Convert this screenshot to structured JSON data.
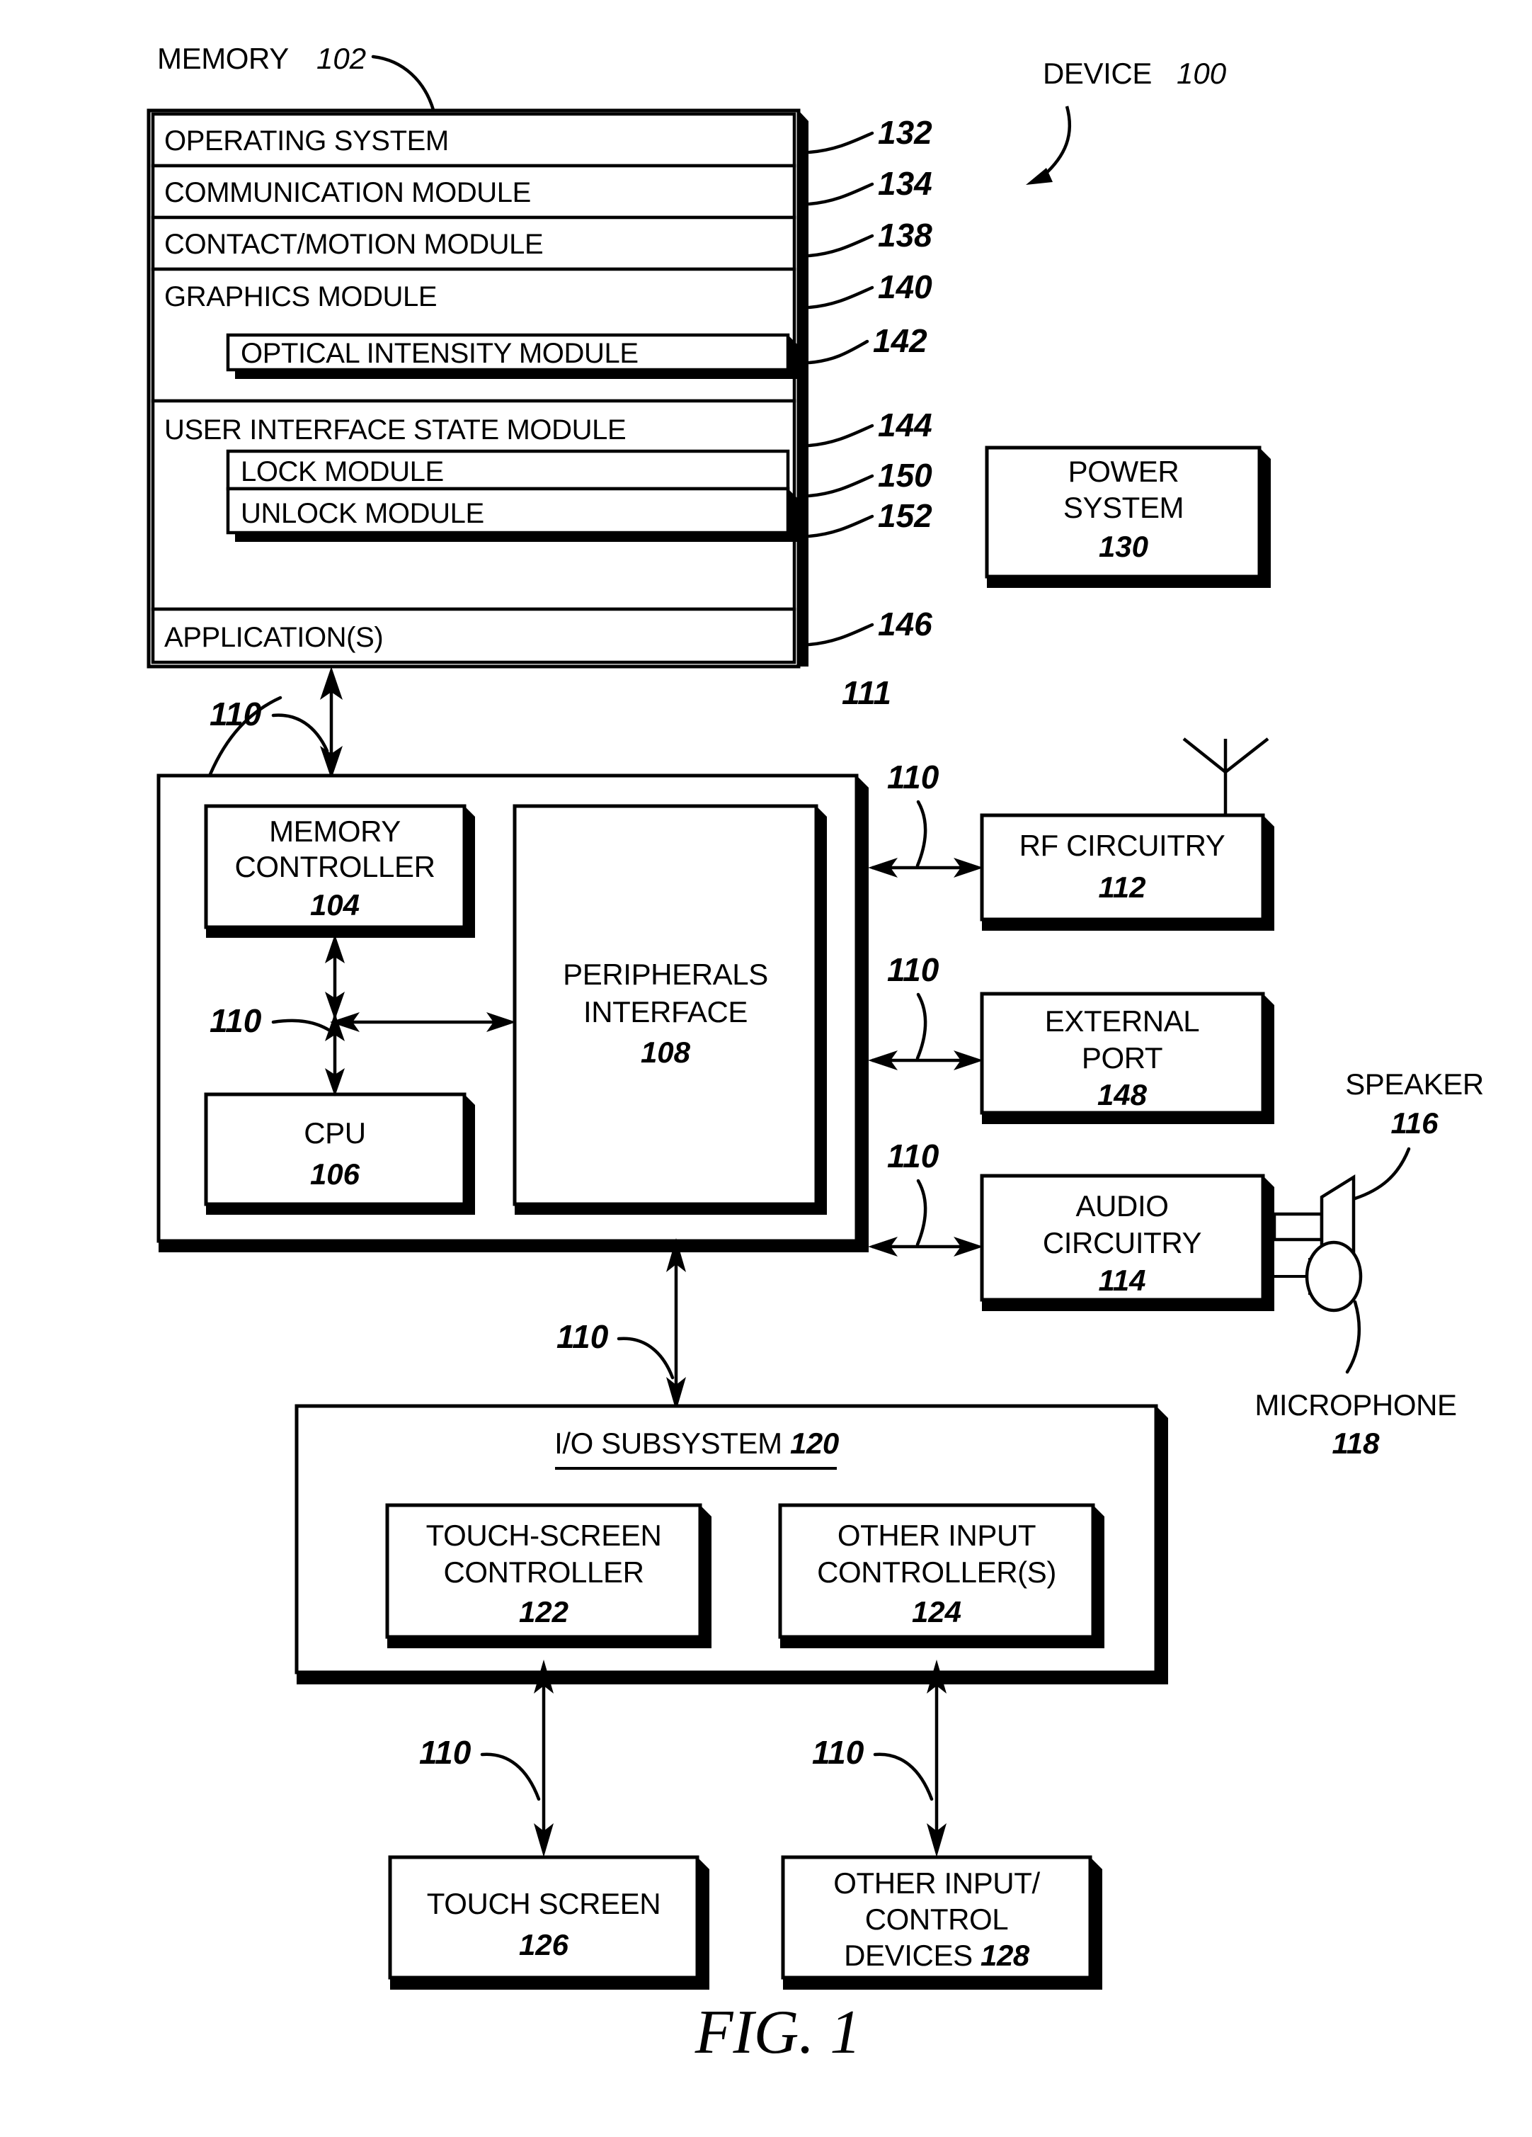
{
  "figure": {
    "caption": "FIG. 1",
    "device_label": "DEVICE",
    "device_ref": "100"
  },
  "memory": {
    "label": "MEMORY",
    "ref": "102",
    "modules": [
      {
        "name": "OPERATING SYSTEM",
        "ref": "132",
        "nested": false
      },
      {
        "name": "COMMUNICATION MODULE",
        "ref": "134",
        "nested": false
      },
      {
        "name": "CONTACT/MOTION MODULE",
        "ref": "138",
        "nested": false
      },
      {
        "name": "GRAPHICS MODULE",
        "ref": "140",
        "nested": false
      },
      {
        "name": "OPTICAL INTENSITY MODULE",
        "ref": "142",
        "nested": true
      },
      {
        "name": "USER INTERFACE STATE MODULE",
        "ref": "144",
        "nested": false
      },
      {
        "name": "LOCK MODULE",
        "ref": "150",
        "nested": true
      },
      {
        "name": "UNLOCK MODULE",
        "ref": "152",
        "nested": true
      },
      {
        "name": "APPLICATION(S)",
        "ref": "146",
        "nested": false
      }
    ]
  },
  "power_system": {
    "line1": "POWER",
    "line2": "SYSTEM",
    "ref": "130"
  },
  "controller": {
    "ref": "111",
    "memory_controller": {
      "line1": "MEMORY",
      "line2": "CONTROLLER",
      "ref": "104"
    },
    "cpu": {
      "line1": "CPU",
      "ref": "106"
    },
    "peripherals_interface": {
      "line1": "PERIPHERALS",
      "line2": "INTERFACE",
      "ref": "108"
    }
  },
  "peripherals": [
    {
      "line1": "RF CIRCUITRY",
      "line2": "",
      "ref": "112"
    },
    {
      "line1": "EXTERNAL",
      "line2": "PORT",
      "ref": "148"
    },
    {
      "line1": "AUDIO",
      "line2": "CIRCUITRY",
      "ref": "114"
    }
  ],
  "speaker": {
    "label": "SPEAKER",
    "ref": "116"
  },
  "microphone": {
    "label": "MICROPHONE",
    "ref": "118"
  },
  "io_subsystem": {
    "title": "I/O SUBSYSTEM",
    "ref": "120",
    "controllers": [
      {
        "line1": "TOUCH-SCREEN",
        "line2": "CONTROLLER",
        "ref": "122"
      },
      {
        "line1": "OTHER INPUT",
        "line2": "CONTROLLER(S)",
        "ref": "124"
      }
    ]
  },
  "io_devices": [
    {
      "line1": "TOUCH SCREEN",
      "line2": "",
      "line3": "",
      "ref": "126",
      "inline_ref": false
    },
    {
      "line1": "OTHER INPUT/",
      "line2": "CONTROL",
      "line3": "DEVICES",
      "ref": "128",
      "inline_ref": true
    }
  ],
  "bus_label": "110",
  "bus_labels": {
    "memory_to_controller": "110",
    "internal_bus": "110",
    "to_rf": "110",
    "to_external_port": "110",
    "to_audio": "110",
    "to_io_subsystem": "110",
    "to_touch_screen": "110",
    "to_other_input": "110"
  },
  "colors": {
    "line": "#000000",
    "fill": "#ffffff"
  }
}
